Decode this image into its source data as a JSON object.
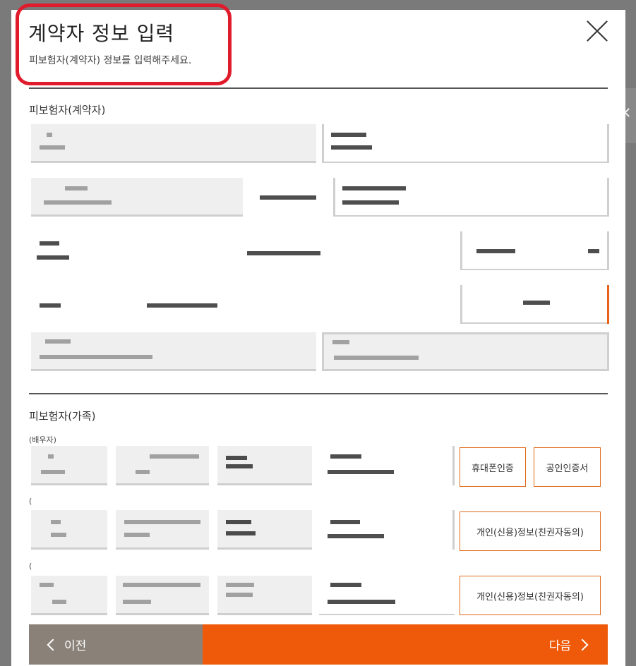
{
  "modal": {
    "title": "계약자 정보 입력",
    "subtitle": "피보험자(계약자) 정보를 입력해주세요."
  },
  "section_insured": {
    "title": "피보험자(계약자)"
  },
  "section_family": {
    "title": "피보험자(가족)",
    "spouse_label": "(배우자)",
    "row2_label": "(",
    "row3_label": "("
  },
  "buttons": {
    "phone_auth": "휴대폰인증",
    "cert_auth": "공인인증서",
    "consent_1": "개인(신용)정보(친권자동의)",
    "consent_2": "개인(신용)정보(친권자동의)",
    "prev": "이전",
    "next": "다음"
  },
  "icons": {
    "close": "close-icon",
    "prev": "chevron-left-icon",
    "next": "chevron-right-icon",
    "side_tab": "chevron-left-icon"
  },
  "colors": {
    "accent": "#ee5a0a",
    "highlight_box": "#e01b2c",
    "prev_bg": "#8a8278"
  }
}
